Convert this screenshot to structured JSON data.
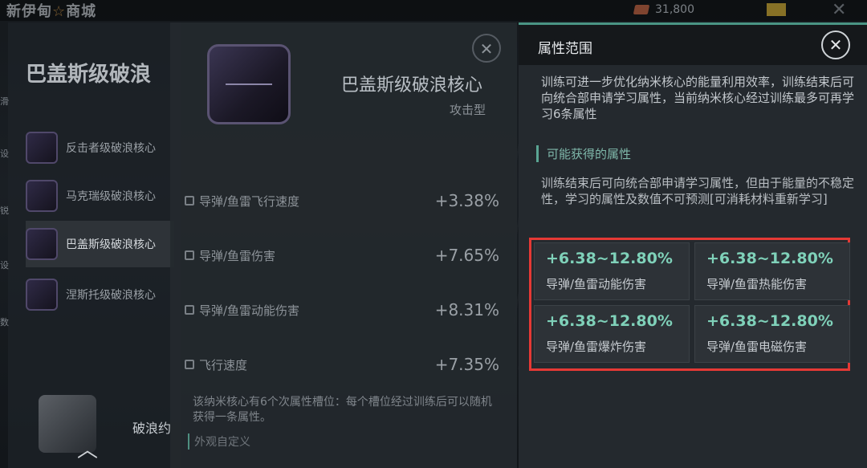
{
  "topbar": {
    "shop_title_part1": "新伊甸",
    "shop_title_star": "☆",
    "shop_title_part2": "商城",
    "currency_amount": "31,800"
  },
  "left_panel": {
    "heading": "巴盖斯级破浪",
    "side_stubs": [
      "滑",
      "设",
      "锐",
      "设",
      "数"
    ],
    "items": [
      {
        "label": "反击者级破浪核心"
      },
      {
        "label": "马克瑞级破浪核心"
      },
      {
        "label": "巴盖斯级破浪核心"
      },
      {
        "label": "涅斯托级破浪核心"
      }
    ],
    "bottom_label": "破浪约"
  },
  "detail": {
    "close_glyph": "✕",
    "core_name": "巴盖斯级破浪核心",
    "core_type": "攻击型",
    "stats": [
      {
        "label": "导弹/鱼雷飞行速度",
        "value": "+3.38%"
      },
      {
        "label": "导弹/鱼雷伤害",
        "value": "+7.65%"
      },
      {
        "label": "导弹/鱼雷动能伤害",
        "value": "+8.31%"
      },
      {
        "label": "飞行速度",
        "value": "+7.35%"
      }
    ],
    "description": "该纳米核心有6个次属性槽位：每个槽位经过训练后可以随机获得一条属性。",
    "subsection": "外观自定义"
  },
  "attribute_panel": {
    "title": "属性范围",
    "close_glyph": "✕",
    "intro": "训练可进一步优化纳米核心的能量利用效率，训练结束后可向统合部申请学习属性，当前纳米核心经过训练最多可再学习6条属性",
    "section_title": "可能获得的属性",
    "section_desc": "训练结束后可向统合部申请学习属性，但由于能量的不稳定性，学习的属性及数值不可预测[可消耗材料重新学习]",
    "attributes": [
      {
        "range": "+6.38~12.80%",
        "name": "导弹/鱼雷动能伤害"
      },
      {
        "range": "+6.38~12.80%",
        "name": "导弹/鱼雷热能伤害"
      },
      {
        "range": "+6.38~12.80%",
        "name": "导弹/鱼雷爆炸伤害"
      },
      {
        "range": "+6.38~12.80%",
        "name": "导弹/鱼雷电磁伤害"
      }
    ]
  },
  "colors": {
    "accent": "#4a9484",
    "range_text": "#7fd1b9",
    "highlight_border": "#e53935"
  }
}
